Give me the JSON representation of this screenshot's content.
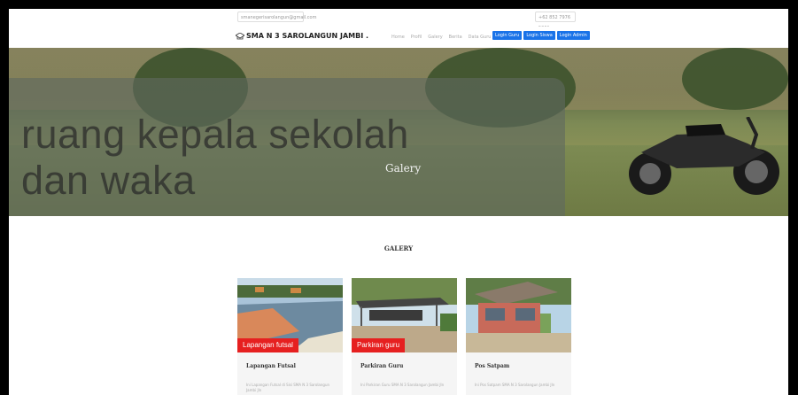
{
  "topbar": {
    "email": "smanegerisarolangun@gmail.com",
    "phone": "+62 852 7976 5001"
  },
  "nav": {
    "brand": "SMA N 3 SAROLANGUN JAMBI .",
    "menu": [
      "Home",
      "Profil",
      "Galery",
      "Berita",
      "Data Guru"
    ],
    "login_buttons": [
      "Login Guru",
      "Login Siswa",
      "Login Admin"
    ]
  },
  "hero": {
    "text_line1": "ruang kepala sekolah",
    "text_line2": "dan waka",
    "label": "Galery"
  },
  "section": {
    "title": "GALERY"
  },
  "cards": [
    {
      "tag": "Lapangan futsal",
      "title": "Lapangan Futsal",
      "desc": "Ini Lapangan Futsal di Sisi SMA N 3 Sarolangun Jambi Jln"
    },
    {
      "tag": "Parkiran guru",
      "title": "Parkiran Guru",
      "desc": "Ini Parkiran Guru SMA N 3 Sarolangun Jambi Jln"
    },
    {
      "tag": "",
      "title": "Pos Satpam",
      "desc": "Ini Pos Satpam SMA N 3 Sarolangun Jambi Jln"
    }
  ],
  "colors": {
    "login_button": "#1a73e8",
    "tag_red": "#e62020"
  }
}
